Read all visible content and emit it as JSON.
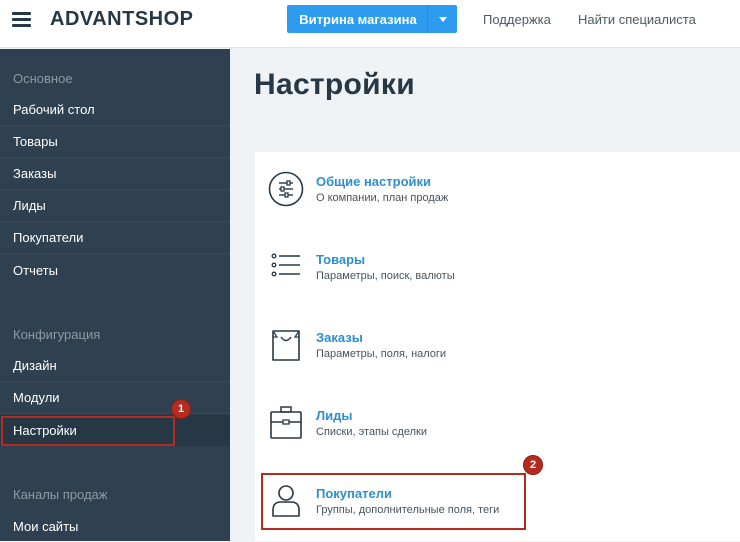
{
  "header": {
    "logo": "ADVANTSHOP",
    "storefront_button": "Витрина магазина",
    "links": [
      "Поддержка",
      "Найти специалиста"
    ]
  },
  "sidebar": {
    "sections": [
      {
        "title": "Основное",
        "items": [
          "Рабочий стол",
          "Товары",
          "Заказы",
          "Лиды",
          "Покупатели",
          "Отчеты"
        ]
      },
      {
        "title": "Конфигурация",
        "items": [
          "Дизайн",
          "Модули",
          "Настройки"
        ]
      },
      {
        "title": "Каналы продаж",
        "items": [
          "Мои сайты"
        ]
      }
    ],
    "active_item": "Настройки"
  },
  "main": {
    "title": "Настройки",
    "settings": [
      {
        "title": "Общие настройки",
        "subtitle": "О компании, план продаж",
        "icon": "sliders-icon"
      },
      {
        "title": "Товары",
        "subtitle": "Параметры, поиск, валюты",
        "icon": "list-icon"
      },
      {
        "title": "Заказы",
        "subtitle": "Параметры, поля, налоги",
        "icon": "shopping-bag-icon"
      },
      {
        "title": "Лиды",
        "subtitle": "Списки, этапы сделки",
        "icon": "briefcase-icon"
      },
      {
        "title": "Покупатели",
        "subtitle": "Группы, дополнительные поля, теги",
        "icon": "user-icon"
      }
    ]
  },
  "annotations": [
    "1",
    "2"
  ],
  "colors": {
    "sidebar_bg": "#2f4050",
    "accent": "#2d9cee",
    "link": "#2d8fcc",
    "highlight": "#b52b20"
  }
}
